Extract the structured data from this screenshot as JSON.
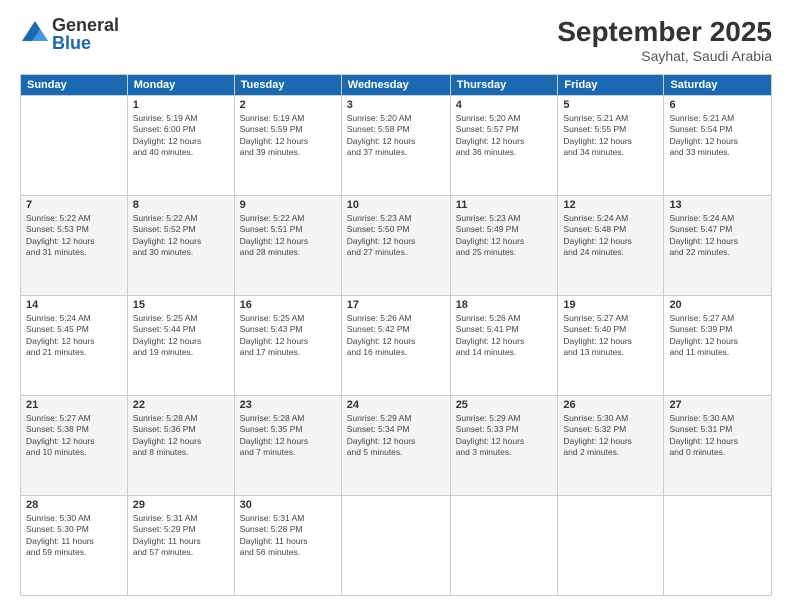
{
  "header": {
    "logo_general": "General",
    "logo_blue": "Blue",
    "month": "September 2025",
    "location": "Sayhat, Saudi Arabia"
  },
  "weekdays": [
    "Sunday",
    "Monday",
    "Tuesday",
    "Wednesday",
    "Thursday",
    "Friday",
    "Saturday"
  ],
  "weeks": [
    [
      {
        "day": "",
        "info": ""
      },
      {
        "day": "1",
        "info": "Sunrise: 5:19 AM\nSunset: 6:00 PM\nDaylight: 12 hours\nand 40 minutes."
      },
      {
        "day": "2",
        "info": "Sunrise: 5:19 AM\nSunset: 5:59 PM\nDaylight: 12 hours\nand 39 minutes."
      },
      {
        "day": "3",
        "info": "Sunrise: 5:20 AM\nSunset: 5:58 PM\nDaylight: 12 hours\nand 37 minutes."
      },
      {
        "day": "4",
        "info": "Sunrise: 5:20 AM\nSunset: 5:57 PM\nDaylight: 12 hours\nand 36 minutes."
      },
      {
        "day": "5",
        "info": "Sunrise: 5:21 AM\nSunset: 5:55 PM\nDaylight: 12 hours\nand 34 minutes."
      },
      {
        "day": "6",
        "info": "Sunrise: 5:21 AM\nSunset: 5:54 PM\nDaylight: 12 hours\nand 33 minutes."
      }
    ],
    [
      {
        "day": "7",
        "info": "Sunrise: 5:22 AM\nSunset: 5:53 PM\nDaylight: 12 hours\nand 31 minutes."
      },
      {
        "day": "8",
        "info": "Sunrise: 5:22 AM\nSunset: 5:52 PM\nDaylight: 12 hours\nand 30 minutes."
      },
      {
        "day": "9",
        "info": "Sunrise: 5:22 AM\nSunset: 5:51 PM\nDaylight: 12 hours\nand 28 minutes."
      },
      {
        "day": "10",
        "info": "Sunrise: 5:23 AM\nSunset: 5:50 PM\nDaylight: 12 hours\nand 27 minutes."
      },
      {
        "day": "11",
        "info": "Sunrise: 5:23 AM\nSunset: 5:49 PM\nDaylight: 12 hours\nand 25 minutes."
      },
      {
        "day": "12",
        "info": "Sunrise: 5:24 AM\nSunset: 5:48 PM\nDaylight: 12 hours\nand 24 minutes."
      },
      {
        "day": "13",
        "info": "Sunrise: 5:24 AM\nSunset: 5:47 PM\nDaylight: 12 hours\nand 22 minutes."
      }
    ],
    [
      {
        "day": "14",
        "info": "Sunrise: 5:24 AM\nSunset: 5:45 PM\nDaylight: 12 hours\nand 21 minutes."
      },
      {
        "day": "15",
        "info": "Sunrise: 5:25 AM\nSunset: 5:44 PM\nDaylight: 12 hours\nand 19 minutes."
      },
      {
        "day": "16",
        "info": "Sunrise: 5:25 AM\nSunset: 5:43 PM\nDaylight: 12 hours\nand 17 minutes."
      },
      {
        "day": "17",
        "info": "Sunrise: 5:26 AM\nSunset: 5:42 PM\nDaylight: 12 hours\nand 16 minutes."
      },
      {
        "day": "18",
        "info": "Sunrise: 5:26 AM\nSunset: 5:41 PM\nDaylight: 12 hours\nand 14 minutes."
      },
      {
        "day": "19",
        "info": "Sunrise: 5:27 AM\nSunset: 5:40 PM\nDaylight: 12 hours\nand 13 minutes."
      },
      {
        "day": "20",
        "info": "Sunrise: 5:27 AM\nSunset: 5:39 PM\nDaylight: 12 hours\nand 11 minutes."
      }
    ],
    [
      {
        "day": "21",
        "info": "Sunrise: 5:27 AM\nSunset: 5:38 PM\nDaylight: 12 hours\nand 10 minutes."
      },
      {
        "day": "22",
        "info": "Sunrise: 5:28 AM\nSunset: 5:36 PM\nDaylight: 12 hours\nand 8 minutes."
      },
      {
        "day": "23",
        "info": "Sunrise: 5:28 AM\nSunset: 5:35 PM\nDaylight: 12 hours\nand 7 minutes."
      },
      {
        "day": "24",
        "info": "Sunrise: 5:29 AM\nSunset: 5:34 PM\nDaylight: 12 hours\nand 5 minutes."
      },
      {
        "day": "25",
        "info": "Sunrise: 5:29 AM\nSunset: 5:33 PM\nDaylight: 12 hours\nand 3 minutes."
      },
      {
        "day": "26",
        "info": "Sunrise: 5:30 AM\nSunset: 5:32 PM\nDaylight: 12 hours\nand 2 minutes."
      },
      {
        "day": "27",
        "info": "Sunrise: 5:30 AM\nSunset: 5:31 PM\nDaylight: 12 hours\nand 0 minutes."
      }
    ],
    [
      {
        "day": "28",
        "info": "Sunrise: 5:30 AM\nSunset: 5:30 PM\nDaylight: 11 hours\nand 59 minutes."
      },
      {
        "day": "29",
        "info": "Sunrise: 5:31 AM\nSunset: 5:29 PM\nDaylight: 11 hours\nand 57 minutes."
      },
      {
        "day": "30",
        "info": "Sunrise: 5:31 AM\nSunset: 5:28 PM\nDaylight: 11 hours\nand 56 minutes."
      },
      {
        "day": "",
        "info": ""
      },
      {
        "day": "",
        "info": ""
      },
      {
        "day": "",
        "info": ""
      },
      {
        "day": "",
        "info": ""
      }
    ]
  ]
}
